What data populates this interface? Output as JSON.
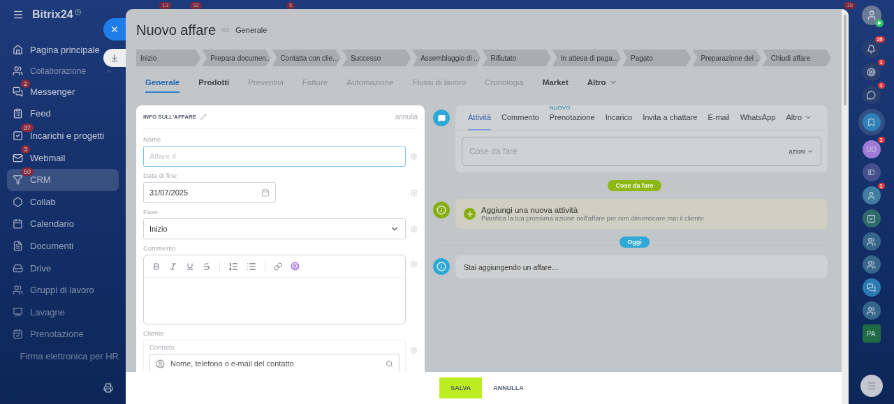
{
  "top_badges": [
    "13",
    "32",
    "5",
    "18"
  ],
  "sidebar": {
    "brand": "Bitrix24",
    "items": [
      {
        "kind": "home",
        "label": "Pagina principale",
        "selected": false
      },
      {
        "kind": "group",
        "label": "Collaborazione",
        "selected": false,
        "expanded": true
      },
      {
        "kind": "chat",
        "label": "Messenger",
        "badge": "2",
        "selected": false
      },
      {
        "kind": "feed",
        "label": "Feed",
        "selected": false
      },
      {
        "kind": "tasks",
        "label": "Incarichi e progetti",
        "badge": "37",
        "selected": false
      },
      {
        "kind": "mail",
        "label": "Webmail",
        "badge": "3",
        "selected": false
      },
      {
        "kind": "crm",
        "label": "CRM",
        "badge": "50",
        "selected": true
      },
      {
        "kind": "collab",
        "label": "Collab",
        "selected": false
      },
      {
        "kind": "calendar",
        "label": "Calendario",
        "selected": false
      },
      {
        "kind": "docs",
        "label": "Documenti",
        "selected": false
      },
      {
        "kind": "drive",
        "label": "Drive",
        "selected": false
      },
      {
        "kind": "groups",
        "label": "Gruppi di lavoro",
        "selected": false
      },
      {
        "kind": "boards",
        "label": "Lavagne",
        "selected": false
      },
      {
        "kind": "booking",
        "label": "Prenotazione",
        "selected": false
      },
      {
        "kind": "sign",
        "label": "Firma elettronica per HR",
        "selected": false
      }
    ]
  },
  "panel": {
    "title": "Nuovo affare",
    "subtitle": "Generale",
    "stages": [
      "Inizio",
      "Prepara documen...",
      "Contatta con clie...",
      "Successo",
      "Assemblaggio di ...",
      "Rifiutato",
      "In attesa di paga...",
      "Pagato",
      "Preparazione del ...",
      "Chiudi affare"
    ],
    "tabs": [
      {
        "label": "Generale",
        "selected": true,
        "disabled": false
      },
      {
        "label": "Prodotti",
        "selected": false,
        "disabled": false
      },
      {
        "label": "Preventivi",
        "selected": false,
        "disabled": true
      },
      {
        "label": "Fatture",
        "selected": false,
        "disabled": true
      },
      {
        "label": "Automazione",
        "selected": false,
        "disabled": true
      },
      {
        "label": "Flussi di lavoro",
        "selected": false,
        "disabled": true
      },
      {
        "label": "Cronologia",
        "selected": false,
        "disabled": true
      },
      {
        "label": "Market",
        "selected": false,
        "disabled": false
      },
      {
        "label": "Altro",
        "selected": false,
        "disabled": false,
        "menu": true
      }
    ]
  },
  "form": {
    "title": "INFO SULL'AFFARE",
    "cancel": "annulla",
    "fields": [
      {
        "kind": "text",
        "label": "Nome",
        "placeholder": "Affare #",
        "focused": true
      },
      {
        "kind": "date",
        "label": "Data di fine",
        "value": "31/07/2025"
      },
      {
        "kind": "select",
        "label": "Fase",
        "value": "Inizio"
      },
      {
        "kind": "editor",
        "label": "Commento"
      },
      {
        "kind": "client",
        "label": "Cliente",
        "sublabel": "Contatto",
        "placeholder": "Nome, telefono o e-mail del contatto"
      }
    ]
  },
  "timeline": {
    "tabs": [
      {
        "label": "Attività",
        "selected": true
      },
      {
        "label": "Commento",
        "selected": false
      },
      {
        "label": "Prenotazione",
        "selected": false,
        "badge": "NUOVO"
      },
      {
        "label": "Incarico",
        "selected": false
      },
      {
        "label": "Invita a chattare",
        "selected": false
      },
      {
        "label": "E-mail",
        "selected": false
      },
      {
        "label": "WhatsApp",
        "selected": false
      },
      {
        "label": "Altro",
        "selected": false,
        "menu": true
      }
    ],
    "input": {
      "placeholder": "Cose da fare",
      "action": "azioni"
    },
    "entries": [
      {
        "kind": "divider",
        "label": "Cose da fare",
        "color": "#8db814"
      },
      {
        "kind": "todo",
        "title": "Aggiungi una nuova attività",
        "text": "Pianifica la tua prossima azione nell'affare per non dimenticare mai il cliente"
      },
      {
        "kind": "divider",
        "label": "Oggi",
        "color": "#2fa8d8"
      },
      {
        "kind": "info",
        "text": "Stai aggiungendo un affare..."
      }
    ]
  },
  "footer": {
    "save": "SALVA",
    "cancel": "ANNULLA"
  },
  "rail": [
    {
      "kind": "bell",
      "badge": "25"
    },
    {
      "kind": "target",
      "badge": "1"
    },
    {
      "kind": "chat",
      "badge": "1"
    },
    {
      "kind": "bookmark",
      "selected": true
    },
    {
      "kind": "initials",
      "text": "UD",
      "badge": "1",
      "color": "#a07ad8"
    },
    {
      "kind": "initials",
      "text": "ID",
      "color": "#45508c"
    },
    {
      "kind": "person",
      "badge": "1"
    },
    {
      "kind": "task"
    },
    {
      "kind": "group"
    },
    {
      "kind": "group"
    },
    {
      "kind": "feed"
    },
    {
      "kind": "group"
    },
    {
      "kind": "hex",
      "text": "PA"
    }
  ]
}
